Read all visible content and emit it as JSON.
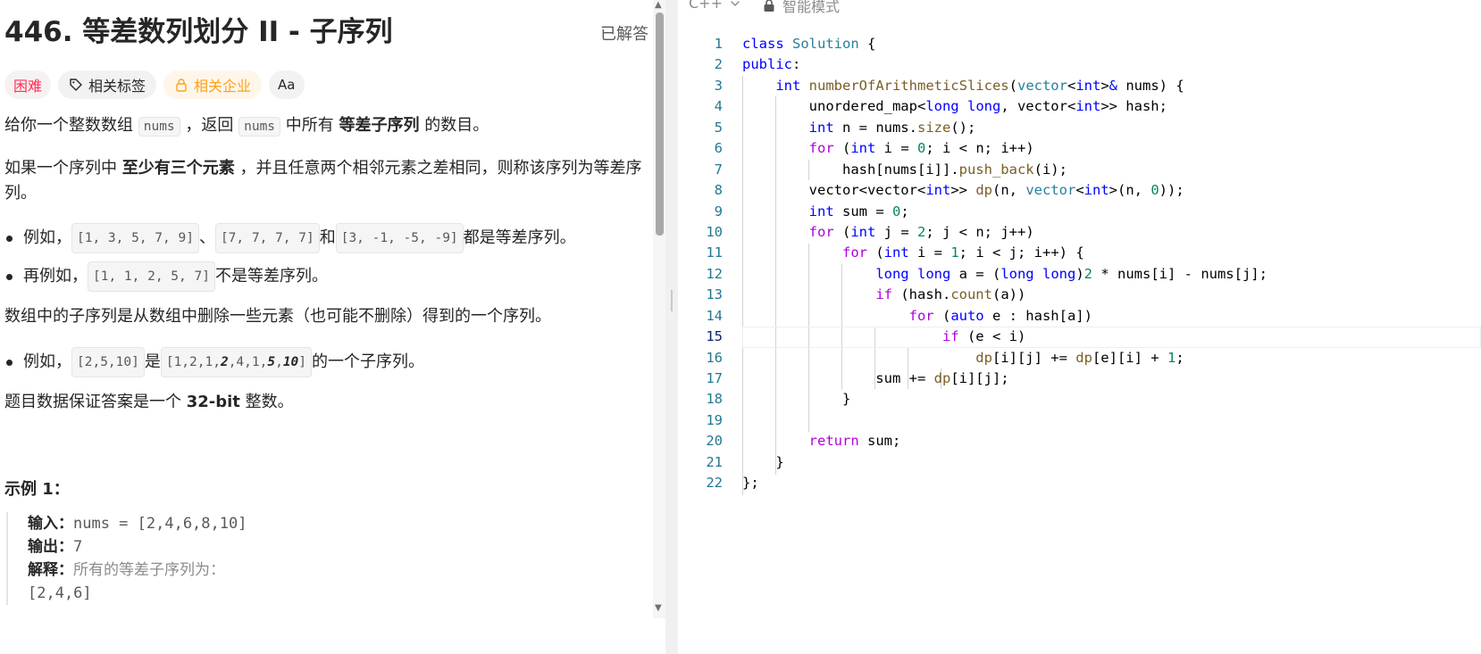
{
  "problem": {
    "title": "446. 等差数列划分 II - 子序列",
    "solved_status": "已解答",
    "tags": {
      "difficulty": "困难",
      "related_tags": "相关标签",
      "related_companies": "相关企业",
      "font_button": "Aa"
    },
    "desc": {
      "p1_a": "给你一个整数数组 ",
      "p1_code1": "nums",
      "p1_b": " ，返回 ",
      "p1_code2": "nums",
      "p1_c": " 中所有 ",
      "p1_bold": "等差子序列",
      "p1_d": " 的数目。",
      "p2_a": "如果一个序列中 ",
      "p2_bold": "至少有三个元素",
      "p2_b": " ，并且任意两个相邻元素之差相同，则称该序列为等差序列。",
      "b1_a": "例如，",
      "b1_code1": "[1, 3, 5, 7, 9]",
      "b1_sep": "、",
      "b1_code2": "[7, 7, 7, 7]",
      "b1_and": " 和 ",
      "b1_code3": "[3, -1, -5, -9]",
      "b1_end": " 都是等差序列。",
      "b2_a": "再例如，",
      "b2_code": "[1, 1, 2, 5, 7]",
      "b2_end": " 不是等差序列。",
      "p3": "数组中的子序列是从数组中删除一些元素（也可能不删除）得到的一个序列。",
      "b3_a": "例如，",
      "b3_code1": "[2,5,10]",
      "b3_is": " 是 ",
      "b3_code2_a": "[1,2,1,",
      "b3_code2_b1": "2",
      "b3_code2_c": ",4,1,",
      "b3_code2_b2": "5",
      "b3_code2_d": ",",
      "b3_code2_b3": "10",
      "b3_code2_e": "]",
      "b3_end": " 的一个子序列。",
      "p4_a": "题目数据保证答案是一个 ",
      "p4_bold": "32-bit",
      "p4_b": " 整数。"
    },
    "example1": {
      "title": "示例 1：",
      "input_label": "输入：",
      "input_value": "nums = [2,4,6,8,10]",
      "output_label": "输出：",
      "output_value": "7",
      "explain_label": "解释：",
      "explain_value": "所有的等差子序列为：",
      "first_seq": "[2,4,6]"
    }
  },
  "editor": {
    "language": "C++",
    "mode": "智能模式",
    "active_line": 15,
    "line_numbers": [
      "1",
      "2",
      "3",
      "4",
      "5",
      "6",
      "7",
      "8",
      "9",
      "10",
      "11",
      "12",
      "13",
      "14",
      "15",
      "16",
      "17",
      "18",
      "19",
      "20",
      "21",
      "22"
    ]
  }
}
